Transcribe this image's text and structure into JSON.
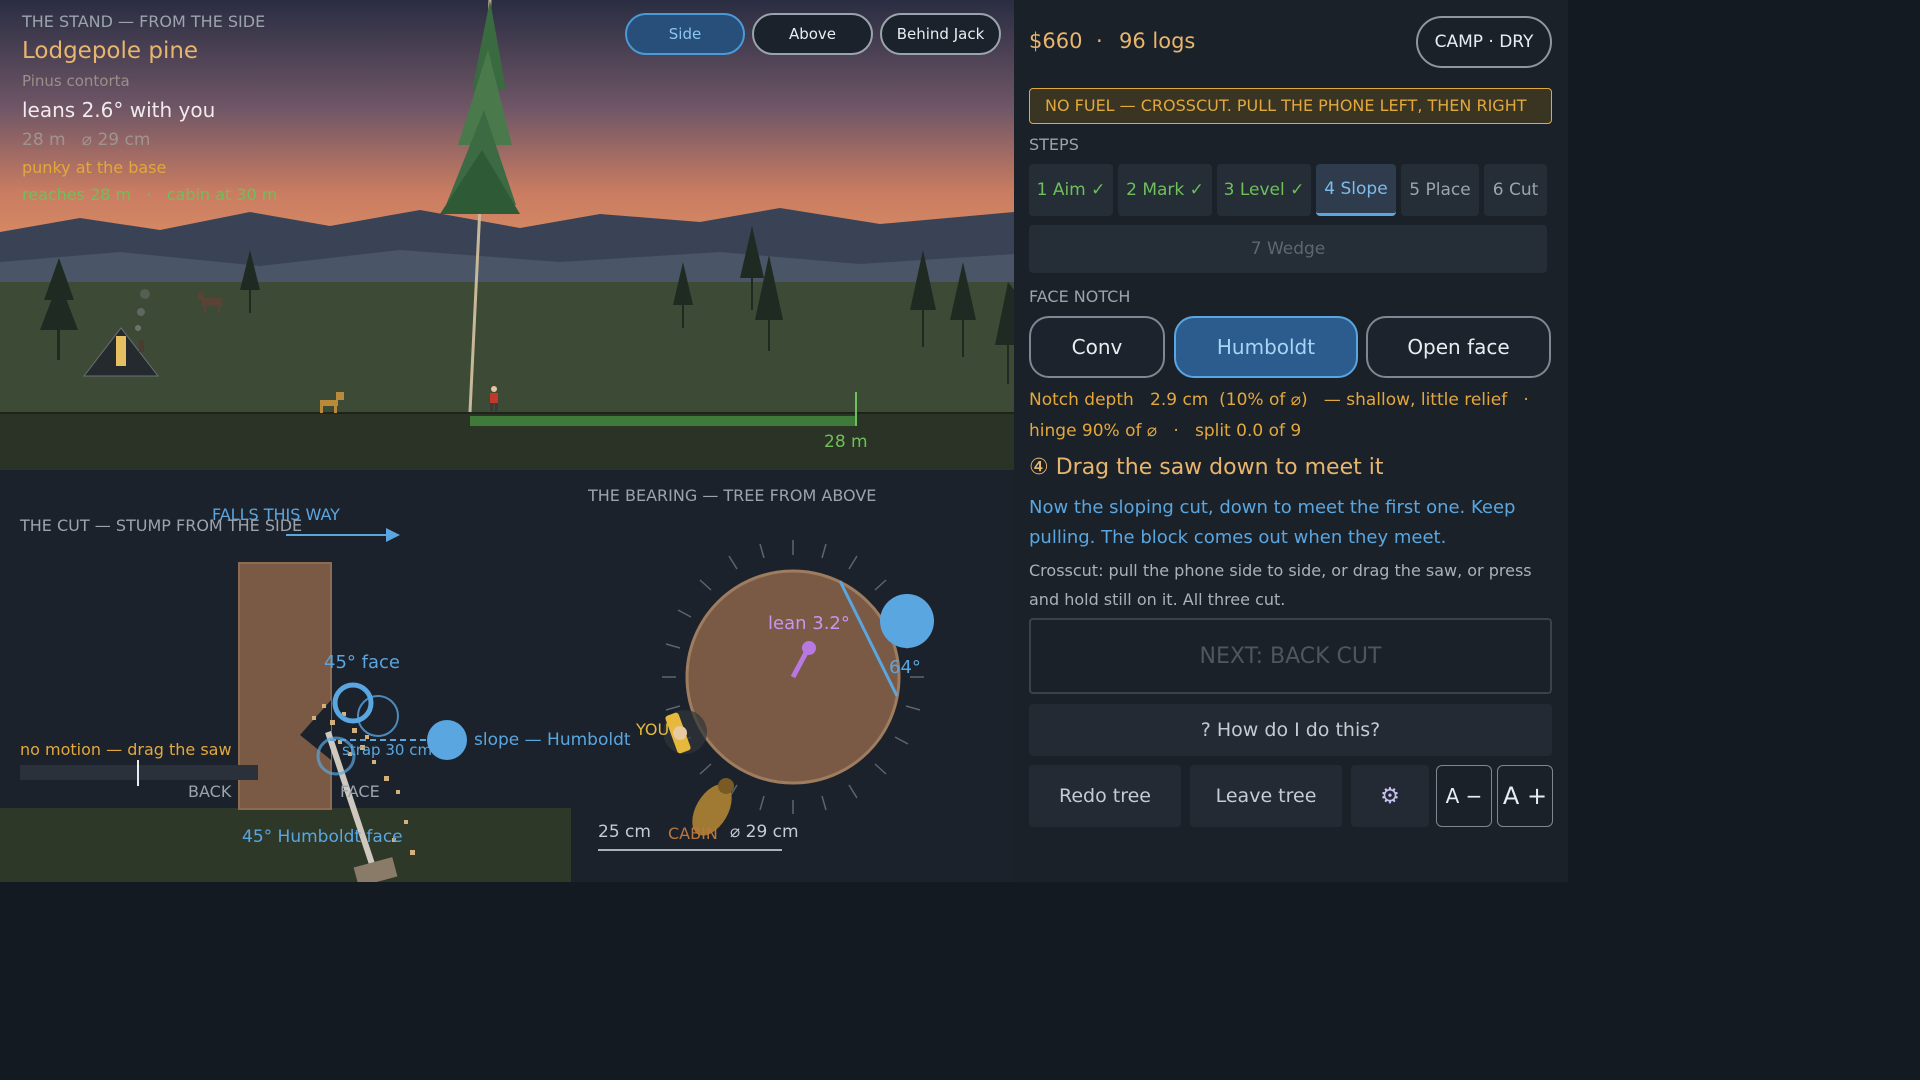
{
  "stand": {
    "heading": "THE STAND — FROM THE SIDE",
    "species": "Lodgepole pine",
    "latin": "Pinus contorta",
    "lean": "leans 2.6° with you",
    "size": "28 m   ⌀ 29 cm",
    "condition": "punky at the base",
    "reach": "reaches 28 m   ·   cabin at 30 m",
    "distance_label": "28 m"
  },
  "views": {
    "side": "Side",
    "above": "Above",
    "behind": "Behind Jack",
    "selected": "Side"
  },
  "cut": {
    "heading": "THE CUT — STUMP FROM THE SIDE",
    "falls": "FALLS THIS WAY",
    "face_angle": "45° face",
    "slope_label": "slope — Humboldt",
    "strap": "strap 30 cm",
    "motion": "no motion — drag the saw",
    "back": "BACK",
    "face": "FACE",
    "humboldt_face": "45° Humboldt face",
    "motion_level": 0.5
  },
  "bearing": {
    "heading": "THE BEARING — TREE FROM ABOVE",
    "lean": "lean 3.2°",
    "angle": "64°",
    "you": "YOU",
    "scale": "25 cm",
    "cabin": "CABIN",
    "diameter": "⌀ 29 cm"
  },
  "panel": {
    "money": "$660",
    "sep": "·",
    "logs": "96 logs",
    "camp": "CAMP · DRY",
    "banner": "NO FUEL — CROSSCUT. PULL THE PHONE LEFT, THEN RIGHT",
    "steps_heading": "STEPS",
    "steps": [
      {
        "label": "1 Aim ✓",
        "state": "done"
      },
      {
        "label": "2 Mark ✓",
        "state": "done"
      },
      {
        "label": "3 Level ✓",
        "state": "done"
      },
      {
        "label": "4 Slope",
        "state": "current"
      },
      {
        "label": "5 Place",
        "state": "todo"
      },
      {
        "label": "6 Cut",
        "state": "todo"
      },
      {
        "label": "7 Wedge",
        "state": "todo"
      }
    ],
    "face_heading": "FACE NOTCH",
    "notches": [
      "Conv",
      "Humboldt",
      "Open face"
    ],
    "notch_selected": "Humboldt",
    "notch_info_1": "Notch depth   2.9 cm  (10% of ⌀)   — shallow, little relief   ·",
    "notch_info_2": "hinge 90% of ⌀   ·   split 0.0 of 9",
    "instruction_title": "④ Drag the saw down to meet it",
    "instruction_body": "Now the sloping cut, down to meet the first one. Keep pulling. The block comes out when they meet.",
    "instruction_hint": "Crosscut: pull the phone side to side, or drag the saw, or press and hold still on it. All three cut.",
    "next": "NEXT: BACK CUT",
    "help": "?  How do I do this?",
    "redo": "Redo tree",
    "leave": "Leave tree",
    "font_smaller": "A −",
    "font_larger": "A +"
  },
  "colors": {
    "accent_blue": "#5aa6e0",
    "done_green": "#6fbf5a",
    "warn_amber": "#e3a83c",
    "lean_purple": "#b779e0",
    "stump_brown": "#7a5a45"
  }
}
